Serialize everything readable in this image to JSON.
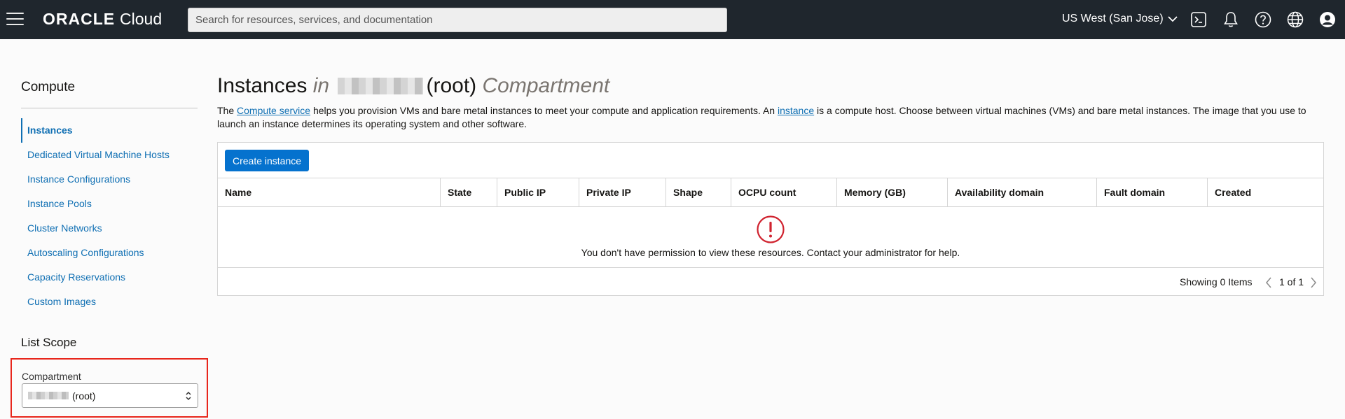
{
  "header": {
    "logo_brand": "ORACLE",
    "logo_product": "Cloud",
    "search_placeholder": "Search for resources, services, and documentation",
    "region": "US West (San Jose)",
    "icons": [
      "menu-icon",
      "cloud-shell-icon",
      "bell-icon",
      "help-icon",
      "globe-icon",
      "user-icon"
    ]
  },
  "sidebar": {
    "title": "Compute",
    "items": [
      {
        "label": "Instances",
        "active": true
      },
      {
        "label": "Dedicated Virtual Machine Hosts"
      },
      {
        "label": "Instance Configurations"
      },
      {
        "label": "Instance Pools"
      },
      {
        "label": "Cluster Networks"
      },
      {
        "label": "Autoscaling Configurations"
      },
      {
        "label": "Capacity Reservations"
      },
      {
        "label": "Custom Images"
      }
    ],
    "scope_title": "List Scope",
    "compartment_label": "Compartment",
    "compartment_value": "(root)"
  },
  "main": {
    "title_main": "Instances",
    "title_in": "in",
    "title_root": "(root)",
    "title_compartment": "Compartment",
    "desc_1": "The ",
    "desc_link1": "Compute service",
    "desc_2": " helps you provision VMs and bare metal instances to meet your compute and application requirements. An ",
    "desc_link2": "instance",
    "desc_3": " is a compute host. Choose between virtual machines (VMs) and bare metal instances. The image that you use to launch an instance determines its operating system and other software.",
    "create_button": "Create instance",
    "columns": [
      "Name",
      "State",
      "Public IP",
      "Private IP",
      "Shape",
      "OCPU count",
      "Memory (GB)",
      "Availability domain",
      "Fault domain",
      "Created"
    ],
    "empty_message": "You don't have permission to view these resources. Contact your administrator for help.",
    "showing": "Showing 0 Items",
    "pager": "1 of 1"
  },
  "colors": {
    "header_bg": "#1f262d",
    "link": "#0f6fb3",
    "primary_button": "#0572ce",
    "error": "#d0232f",
    "highlight_box": "#e8261c"
  }
}
